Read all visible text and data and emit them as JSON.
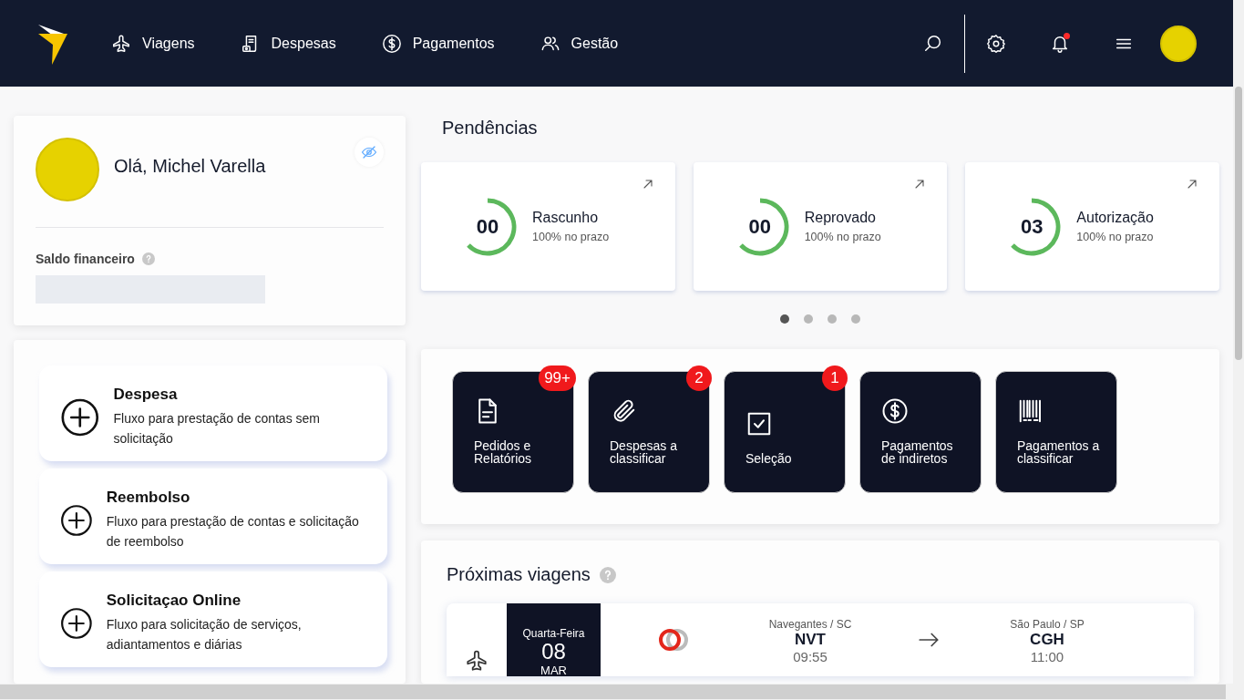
{
  "nav": {
    "items": [
      {
        "label": "Viagens"
      },
      {
        "label": "Despesas"
      },
      {
        "label": "Pagamentos"
      },
      {
        "label": "Gestão"
      }
    ],
    "notifications_unread": true
  },
  "profile": {
    "greeting": "Olá, Michel Varella",
    "balance_label": "Saldo financeiro",
    "balance_hidden": true
  },
  "actions": [
    {
      "title": "Despesa",
      "description": "Fluxo para prestação de contas sem solicitação"
    },
    {
      "title": "Reembolso",
      "description": "Fluxo para prestação de contas e solicitação de reembolso"
    },
    {
      "title": "Solicitaçao Online",
      "description": "Fluxo para solicitação de serviços, adiantamentos e diárias"
    }
  ],
  "pendencias": {
    "title": "Pendências",
    "cards": [
      {
        "count": "00",
        "label": "Rascunho",
        "subtitle": "100% no prazo"
      },
      {
        "count": "00",
        "label": "Reprovado",
        "subtitle": "100% no prazo"
      },
      {
        "count": "03",
        "label": "Autorização",
        "subtitle": "100% no prazo"
      }
    ],
    "dots": [
      {
        "selected": true
      },
      {
        "selected": false
      },
      {
        "selected": false
      },
      {
        "selected": false
      }
    ]
  },
  "shortcuts": [
    {
      "label": "Pedidos e Relatórios",
      "badge": "99+"
    },
    {
      "label": "Despesas a classificar",
      "badge": "2"
    },
    {
      "label": "Seleção",
      "badge": "1"
    },
    {
      "label": "Pagamentos de indiretos"
    },
    {
      "label": "Pagamentos a classificar"
    }
  ],
  "trips": {
    "title": "Próximas viagens",
    "items": [
      {
        "weekday": "Quarta-Feira",
        "day": "08",
        "month": "MAR",
        "origin_city": "Navegantes / SC",
        "origin_code": "NVT",
        "departure": "09:55",
        "destination_city": "São Paulo / SP",
        "destination_code": "CGH",
        "arrival": "11:00"
      }
    ]
  }
}
